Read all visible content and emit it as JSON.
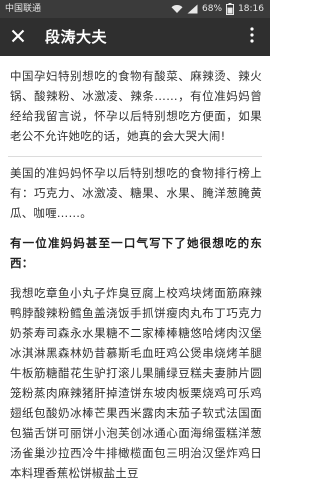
{
  "status_bar": {
    "carrier": "中国联通",
    "battery_percent": "68%",
    "time": "18:16",
    "icons": [
      "wifi-icon",
      "signal-icon",
      "battery-icon"
    ]
  },
  "header": {
    "title": "段涛大夫",
    "close_icon": "close-icon",
    "more_icon": "more-vertical-icon"
  },
  "article": {
    "p1": "中国孕妇特别想吃的食物有酸菜、麻辣烫、辣火锅、酸辣粉、冰激凌、辣条……，有位准妈妈曾经给我留言说，怀孕以后特别想吃方便面，如果老公不允许她吃的话，她真的会大哭大闹!",
    "p2": "美国的准妈妈怀孕以后特别想吃的食物排行榜上有：巧克力、冰激凌、糖果、水果、腌洋葱腌黄瓜、咖喱……。",
    "p3": "有一位准妈妈甚至一口气写下了她很想吃的东西：",
    "p4": "我想吃章鱼小丸子炸臭豆腐上校鸡块烤面筋麻辣鸭脖酸辣粉鳕鱼盖浇饭手抓饼瘦肉丸布丁巧克力奶茶寿司森永水果糖不二家棒棒糖悠哈烤肉汉堡冰淇淋黑森林奶昔慕斯毛血旺鸡公煲串烧烤羊腿牛板筋糖醋花生驴打滚儿果脯绿豆糕夫妻肺片圆笼粉蒸肉麻辣猪肝掉渣饼东坡肉板栗烧鸡可乐鸡翅纸包酸奶冰棒芒果西米露肉末茄子软式法国面包猫舌饼可丽饼小泡芙创冰通心面海绵蛋糕洋葱汤雀巢沙拉西冷牛排橄榄面包三明治汉堡炸鸡日本料理香蕉松饼椒盐土豆"
  }
}
